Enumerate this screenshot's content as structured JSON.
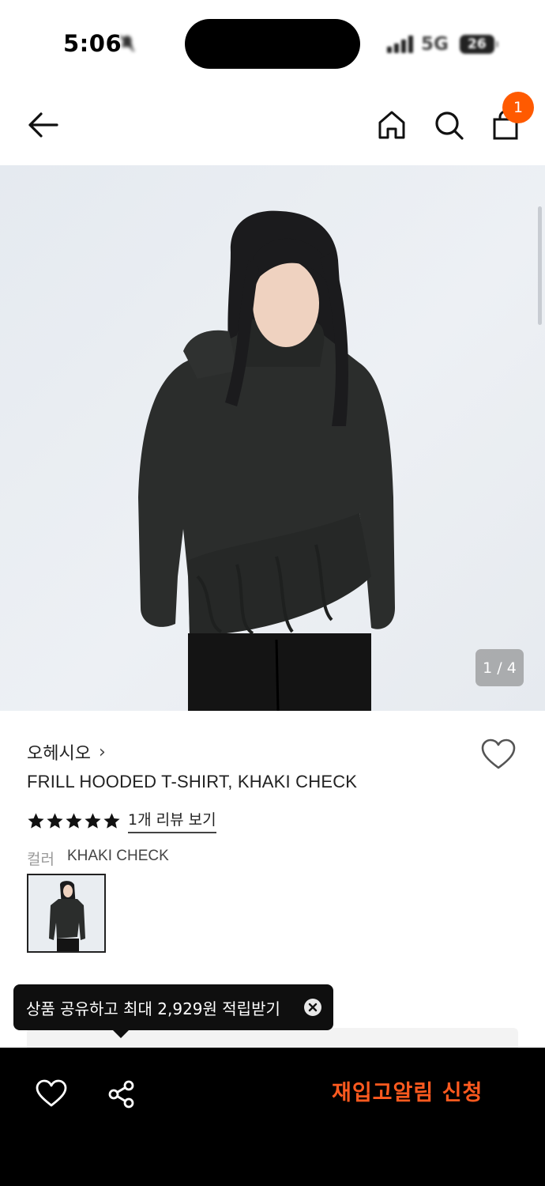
{
  "status_bar": {
    "time": "5:06",
    "network": "5G",
    "battery": "26"
  },
  "nav": {
    "back_icon": "arrow-left-icon",
    "home_icon": "home-icon",
    "search_icon": "search-icon",
    "cart_icon": "shopping-bag-icon",
    "cart_count": "1"
  },
  "gallery": {
    "current": "1",
    "total": "4",
    "counter_text": "1 / 4"
  },
  "product": {
    "brand": "오헤시오",
    "brand_chevron": "›",
    "title": "FRILL HOODED T-SHIRT, KHAKI CHECK",
    "rating_stars": 5,
    "review_link": "1개 리뷰 보기",
    "color_label": "컬러",
    "color_value": "KHAKI CHECK"
  },
  "tooltip": {
    "text": "상품 공유하고 최대 2,929원 적립받기"
  },
  "bottom_bar": {
    "restock_label": "재입고알림 신청"
  },
  "colors": {
    "accent": "#ff5a1f",
    "badge": "#ff5a00",
    "bottom_bar_bg": "#000000"
  }
}
